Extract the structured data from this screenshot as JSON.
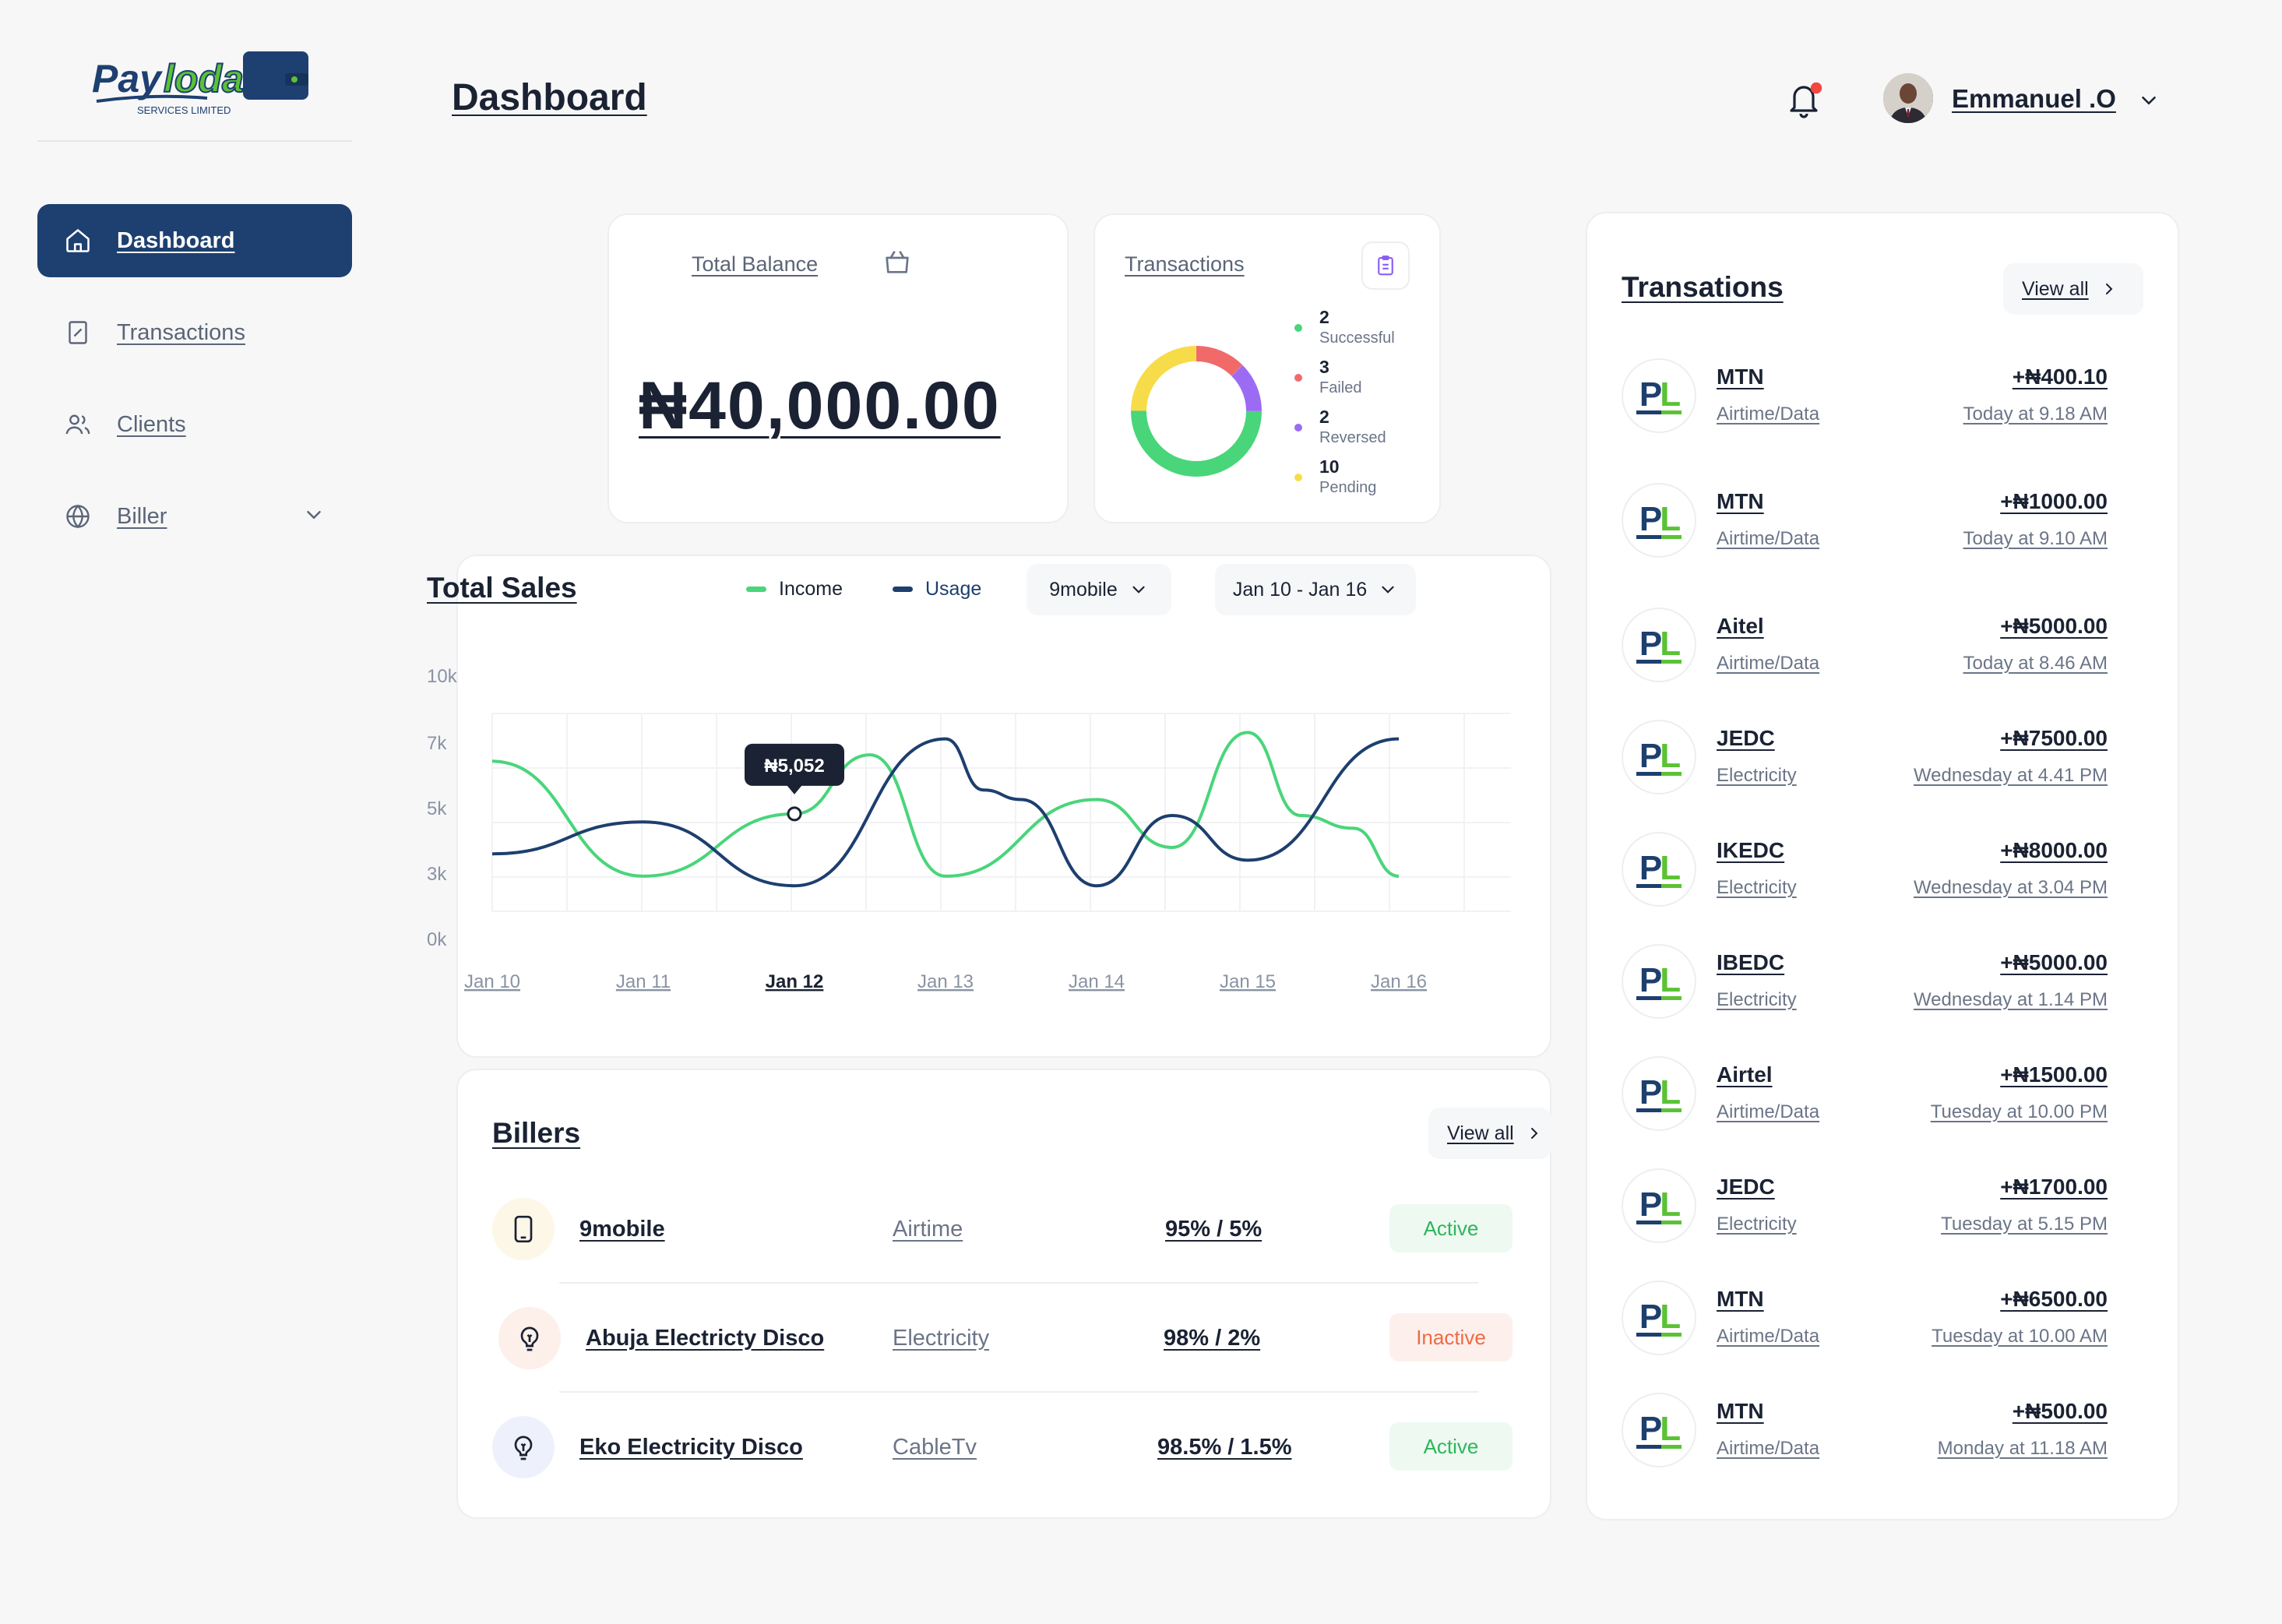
{
  "app": {
    "logo_text": "Payloda",
    "logo_subtext": "SERVICES LIMITED",
    "page_title": "Dashboard"
  },
  "sidebar": {
    "items": [
      {
        "label": "Dashboard",
        "icon": "home-icon",
        "active": true
      },
      {
        "label": "Transactions",
        "icon": "receipt-icon",
        "active": false
      },
      {
        "label": "Clients",
        "icon": "users-icon",
        "active": false
      },
      {
        "label": "Biller",
        "icon": "globe-icon",
        "active": false,
        "has_submenu": true
      }
    ]
  },
  "header": {
    "user_name": "Emmanuel .O",
    "has_notification": true
  },
  "balance": {
    "title": "Total Balance",
    "amount": "₦40,000.00"
  },
  "tx_summary": {
    "title": "Transactions",
    "items": [
      {
        "count": "2",
        "label": "Successful",
        "color": "#49d57a"
      },
      {
        "count": "3",
        "label": "Failed",
        "color": "#f16a6a"
      },
      {
        "count": "2",
        "label": "Reversed",
        "color": "#9b6cf3"
      },
      {
        "count": "10",
        "label": "Pending",
        "color": "#f7dc4a"
      }
    ]
  },
  "sales": {
    "title": "Total Sales",
    "legend_income": "Income",
    "legend_usage": "Usage",
    "filter_provider": "9mobile",
    "filter_range": "Jan 10 - Jan 16",
    "tooltip": "₦5,052",
    "colors": {
      "income": "#49d57a",
      "usage": "#1d3f6e"
    }
  },
  "chart_data": {
    "type": "line",
    "x": [
      "Jan 10",
      "Jan 11",
      "Jan 12",
      "Jan 13",
      "Jan 14",
      "Jan 15",
      "Jan 16"
    ],
    "highlight_x": "Jan 12",
    "y_ticks": [
      "10k",
      "7k",
      "5k",
      "3k",
      "0k"
    ],
    "ylim": [
      0,
      10000
    ],
    "series": [
      {
        "name": "Income",
        "points": [
          [
            0,
            6700
          ],
          [
            1.0,
            3100
          ],
          [
            2.0,
            5052
          ],
          [
            2.5,
            6900
          ],
          [
            3.0,
            3100
          ],
          [
            4.0,
            5500
          ],
          [
            4.5,
            4000
          ],
          [
            5.0,
            7600
          ],
          [
            5.35,
            5000
          ],
          [
            5.7,
            4600
          ],
          [
            6.0,
            3100
          ]
        ]
      },
      {
        "name": "Usage",
        "points": [
          [
            0,
            3800
          ],
          [
            1.0,
            4800
          ],
          [
            2.0,
            2800
          ],
          [
            3.0,
            7400
          ],
          [
            3.25,
            5800
          ],
          [
            3.5,
            5500
          ],
          [
            4.0,
            2800
          ],
          [
            4.5,
            5000
          ],
          [
            5.0,
            3600
          ],
          [
            6.0,
            7400
          ]
        ]
      }
    ]
  },
  "billers": {
    "title": "Billers",
    "view_all": "View all",
    "rows": [
      {
        "name": "9mobile",
        "type": "Airtime",
        "share": "95% / 5%",
        "status": "Active",
        "icon": "phone-icon"
      },
      {
        "name": "Abuja Electricty Disco",
        "type": "Electricity",
        "share": "98% / 2%",
        "status": "Inactive",
        "icon": "bulb-icon"
      },
      {
        "name": "Eko Electricity Disco",
        "type": "CableTv",
        "share": "98.5% / 1.5%",
        "status": "Active",
        "icon": "bulb-icon"
      }
    ]
  },
  "transactions": {
    "title": "Transations",
    "view_all": "View all",
    "items": [
      {
        "name": "MTN",
        "category": "Airtime/Data",
        "amount": "+₦400.10",
        "time": "Today at 9.18 AM"
      },
      {
        "name": "MTN",
        "category": "Airtime/Data",
        "amount": "+₦1000.00",
        "time": "Today at 9.10 AM"
      },
      {
        "name": "Aitel",
        "category": "Airtime/Data",
        "amount": "+₦5000.00",
        "time": "Today at 8.46 AM"
      },
      {
        "name": "JEDC",
        "category": "Electricity",
        "amount": "+₦7500.00",
        "time": "Wednesday at 4.41 PM"
      },
      {
        "name": "IKEDC",
        "category": "Electricity",
        "amount": "+₦8000.00",
        "time": "Wednesday at 3.04 PM"
      },
      {
        "name": "IBEDC",
        "category": "Electricity",
        "amount": "+₦5000.00",
        "time": "Wednesday at 1.14 PM"
      },
      {
        "name": "Airtel",
        "category": "Airtime/Data",
        "amount": "+₦1500.00",
        "time": "Tuesday at 10.00 PM"
      },
      {
        "name": "JEDC",
        "category": "Electricity",
        "amount": "+₦1700.00",
        "time": "Tuesday at 5.15 PM"
      },
      {
        "name": "MTN",
        "category": "Airtime/Data",
        "amount": "+₦6500.00",
        "time": "Tuesday at 10.00 AM"
      },
      {
        "name": "MTN",
        "category": "Airtime/Data",
        "amount": "+₦500.00",
        "time": "Monday at 11.18 AM"
      }
    ]
  }
}
